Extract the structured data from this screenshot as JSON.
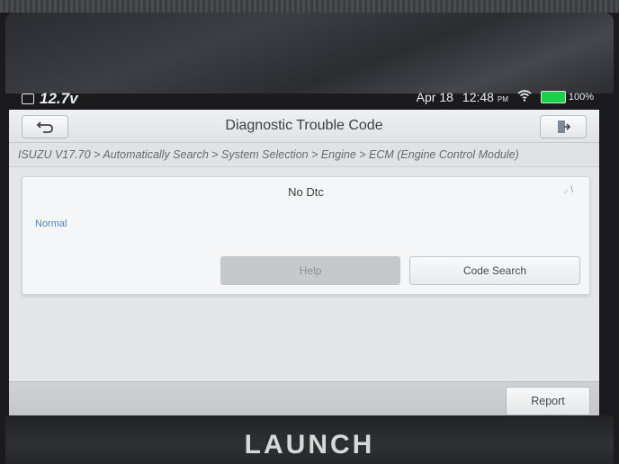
{
  "status_bar": {
    "voltage": "12.7v",
    "date": "Apr 18",
    "time": "12:48",
    "ampm": "PM",
    "battery": "100%"
  },
  "header": {
    "title": "Diagnostic Trouble Code"
  },
  "breadcrumb": "ISUZU V17.70 > Automatically Search > System Selection > Engine > ECM (Engine Control Module)",
  "dtc_card": {
    "title": "No Dtc",
    "status": "Normal",
    "help_label": "Help",
    "code_search_label": "Code Search"
  },
  "footer": {
    "report_label": "Report"
  },
  "device": {
    "brand": "LAUNCH"
  },
  "colors": {
    "battery": "#19d24a",
    "status_text": "#4a86c8"
  },
  "icons": {
    "back": "back-arrow-icon",
    "exit": "exit-door-icon",
    "wifi": "wifi-icon",
    "sd": "sd-card-icon"
  }
}
